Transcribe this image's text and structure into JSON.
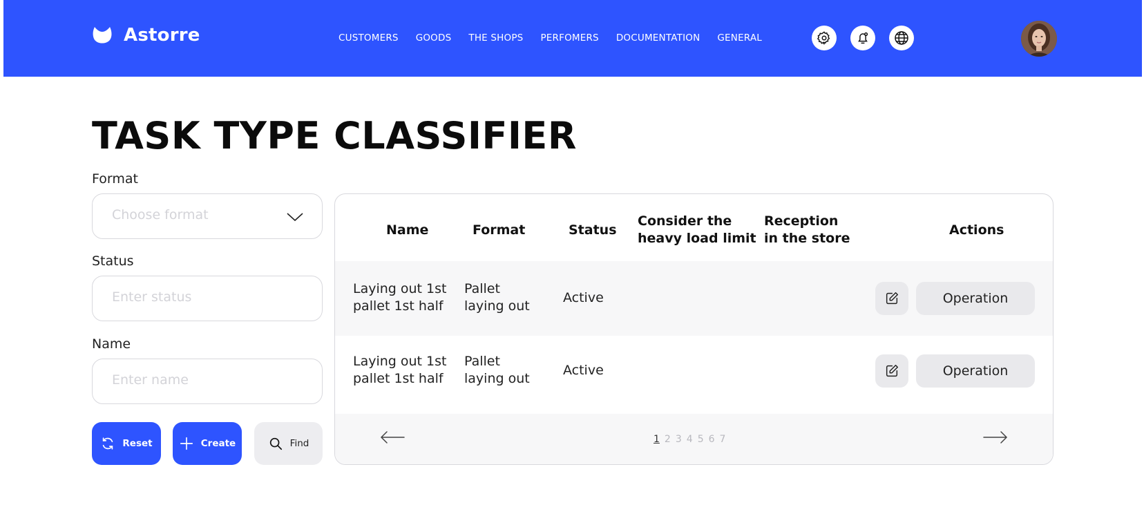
{
  "app": {
    "name": "Astorre",
    "brand_color": "#2E54FF"
  },
  "nav": {
    "items": [
      {
        "label": "CUSTOMERS"
      },
      {
        "label": "GOODS"
      },
      {
        "label": "THE SHOPS"
      },
      {
        "label": "PERFOMERS"
      },
      {
        "label": "DOCUMENTATION"
      },
      {
        "label": "GENERAL"
      }
    ],
    "icons": [
      "gear-icon",
      "bell-icon",
      "globe-icon"
    ]
  },
  "page": {
    "title": "TASK TYPE CLASSIFIER"
  },
  "filters": {
    "format": {
      "label": "Format",
      "placeholder": "Choose format",
      "value": ""
    },
    "status": {
      "label": "Status",
      "placeholder": "Enter status",
      "value": ""
    },
    "name": {
      "label": "Name",
      "placeholder": "Enter name",
      "value": ""
    },
    "buttons": {
      "reset": "Reset",
      "create": "Create",
      "find": "Find"
    }
  },
  "table": {
    "columns": {
      "name": "Name",
      "format": "Format",
      "status": "Status",
      "heavy_load": "Consider the\nheavy load limit",
      "reception": "Reception\nin the store",
      "actions": "Actions"
    },
    "rows": [
      {
        "name": "Laying out 1st\npallet 1st half",
        "format": "Pallet\nlaying out",
        "status": "Active",
        "heavy_load": "",
        "reception": "",
        "action_label": "Operation"
      },
      {
        "name": "Laying out 1st\npallet 1st half",
        "format": "Pallet\nlaying out",
        "status": "Active",
        "heavy_load": "",
        "reception": "",
        "action_label": "Operation"
      }
    ],
    "pagination": {
      "pages": [
        "1",
        "2",
        "3",
        "4",
        "5",
        "6",
        "7"
      ],
      "current": "1"
    }
  }
}
